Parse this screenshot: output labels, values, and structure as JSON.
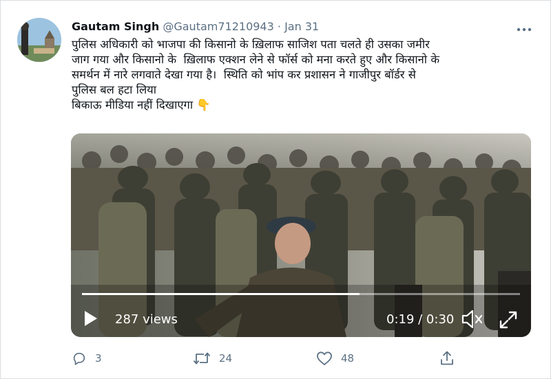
{
  "tweet": {
    "author_name": "Gautam Singh",
    "handle": "@Gautam71210943",
    "separator": "·",
    "date": "Jan 31",
    "menu_icon": "more-icon",
    "text_line_1": "पुलिस अधिकारी को भाजपा की किसानो के ख़िलाफ साजिश पता चलते ही उसका जमीर",
    "text_line_2": "जाग गया और किसानो के  ख़िलाफ एक्शन लेने से फॉर्स को मना करते हुए और किसानो के",
    "text_line_3": "समर्थन में नारे लगवाते देखा गया है।  स्थिति को भांप कर प्रशासन ने गाजीपुर बॉर्डर से",
    "text_line_4": "पुलिस बल हटा लिया",
    "text_line_5": "बिकाऊ मीडिया नहीं दिखाएगा",
    "emoji": "👇"
  },
  "video": {
    "views": "287 views",
    "time": "0:19 / 0:30",
    "progress": 0.633,
    "icons": [
      "play-icon",
      "volume-icon",
      "expand-icon"
    ]
  },
  "actions": {
    "replies": "3",
    "retweets": "24",
    "likes": "48",
    "icons": [
      "reply-icon",
      "retweet-icon",
      "like-icon",
      "share-icon"
    ]
  },
  "colors": {
    "text": "#0f1419",
    "secondary": "#5b7083",
    "border": "#d7dde2"
  }
}
